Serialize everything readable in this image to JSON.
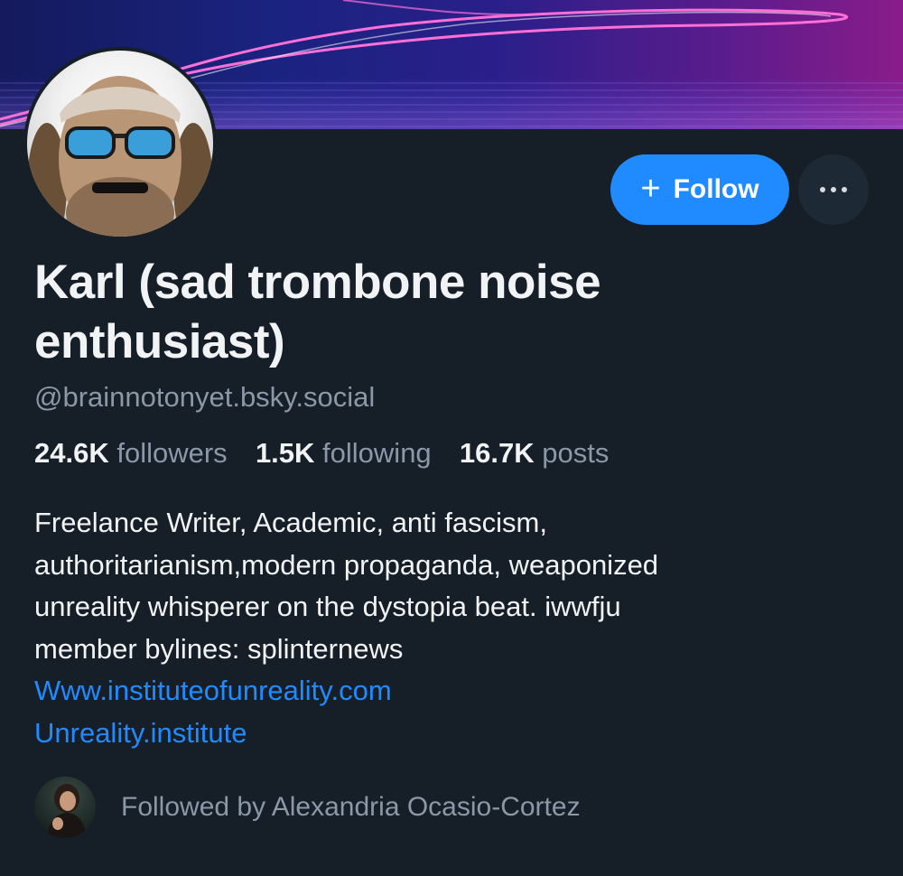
{
  "profile": {
    "display_name": "Karl (sad trombone noise enthusiast)",
    "handle": "@brainnotonyet.bsky.social",
    "stats": {
      "followers_count": "24.6K",
      "followers_label": "followers",
      "following_count": "1.5K",
      "following_label": "following",
      "posts_count": "16.7K",
      "posts_label": "posts"
    },
    "bio_lines": [
      "Freelance Writer, Academic, anti fascism,",
      "authoritarianism,modern propaganda, weaponized",
      "unreality whisperer on the dystopia beat. iwwfju",
      "member bylines: splinternews"
    ],
    "links": [
      "Www.instituteofunreality.com",
      "Unreality.institute"
    ],
    "followed_by": "Followed by Alexandria Ocasio-Cortez"
  },
  "actions": {
    "follow_icon": "plus-icon",
    "follow_label": "Follow",
    "more_icon": "ellipsis-icon"
  },
  "colors": {
    "background": "#161e27",
    "accent": "#208bfe",
    "muted_text": "#8a98a8",
    "primary_text": "#f1f3f5"
  }
}
